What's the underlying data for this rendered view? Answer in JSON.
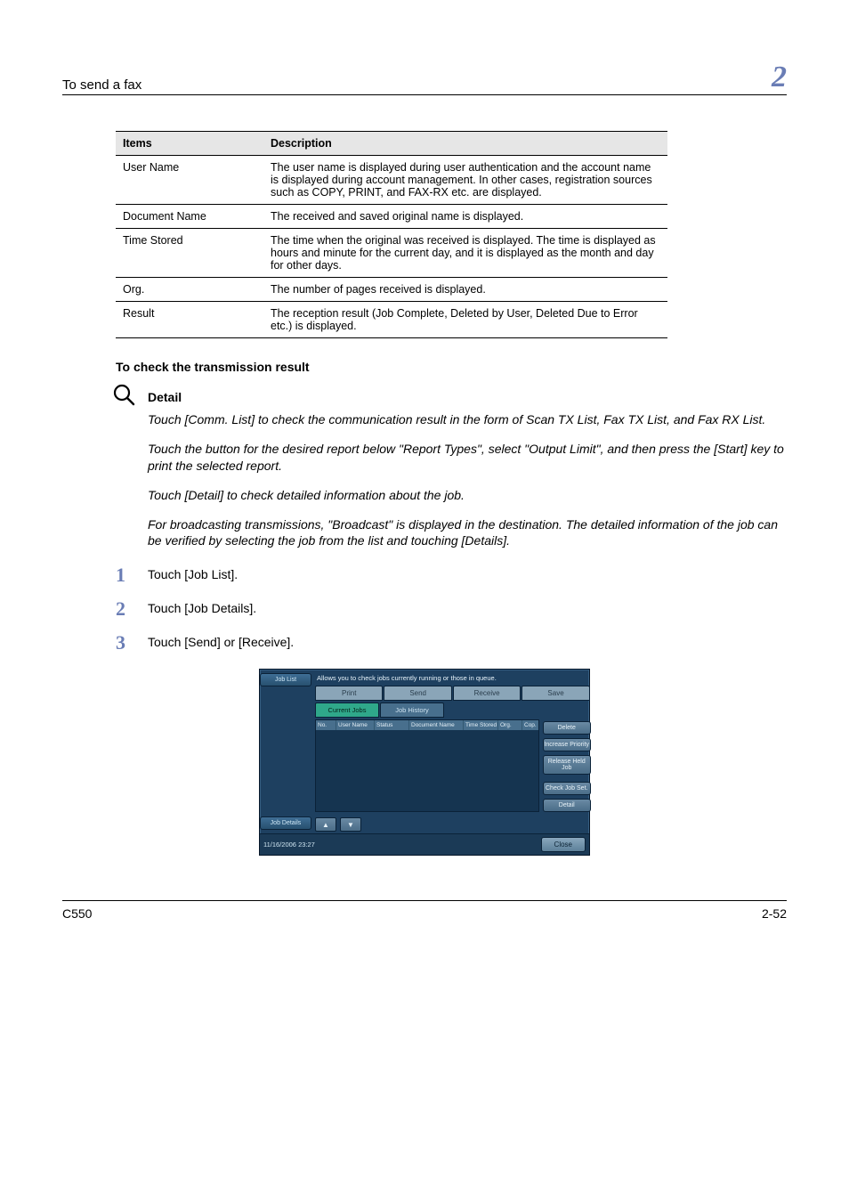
{
  "header": {
    "title": "To send a fax",
    "chapter": "2"
  },
  "table": {
    "head_items": "Items",
    "head_desc": "Description",
    "rows": [
      {
        "item": "User Name",
        "desc": "The user name is displayed during user authentication and the account name is displayed during account management. In other cases, registration sources such as COPY, PRINT, and FAX-RX etc. are displayed."
      },
      {
        "item": "Document Name",
        "desc": "The received and saved original name is displayed."
      },
      {
        "item": "Time Stored",
        "desc": "The time when the original was received is displayed. The time is displayed as hours and minute for the current day, and it is displayed as the month and day for other days."
      },
      {
        "item": "Org.",
        "desc": "The number of pages received is displayed."
      },
      {
        "item": "Result",
        "desc": "The reception result (Job Complete, Deleted by User, Deleted Due to Error etc.) is displayed."
      }
    ]
  },
  "section_title": "To check the transmission result",
  "detail": {
    "label": "Detail",
    "p1": "Touch [Comm. List] to check the communication result in the form of Scan TX List, Fax TX List, and Fax RX List.",
    "p2": "Touch the button for the desired report below \"Report Types\", select \"Output Limit\", and then press the [Start] key to print the selected report.",
    "p3": "Touch [Detail] to check detailed information about the job.",
    "p4": "For broadcasting transmissions, \"Broadcast\" is displayed in the destination. The detailed information of the job can be verified by selecting the job from the list and touching [Details]."
  },
  "steps": {
    "s1": "Touch [Job List].",
    "s2": "Touch [Job Details].",
    "s3": "Touch [Send] or [Receive]."
  },
  "ui": {
    "side_top": "Job List",
    "side_bottom": "Job Details",
    "hint": "Allows you to check jobs currently running or those in queue.",
    "tabs": {
      "print": "Print",
      "send": "Send",
      "receive": "Receive",
      "save": "Save"
    },
    "subtabs": {
      "current": "Current Jobs",
      "history": "Job History"
    },
    "cols": {
      "no": "No.",
      "user": "User Name",
      "status": "Status",
      "doc": "Document Name",
      "time": "Time Stored",
      "org": "Org.",
      "cop": "Cop."
    },
    "actions": {
      "delete": "Delete",
      "priority": "Increase Priority",
      "release": "Release Held Job",
      "check": "Check Job Set.",
      "detail": "Detail"
    },
    "close": "Close",
    "timestamp": "11/16/2006   23:27"
  },
  "footer": {
    "left": "C550",
    "right": "2-52"
  }
}
